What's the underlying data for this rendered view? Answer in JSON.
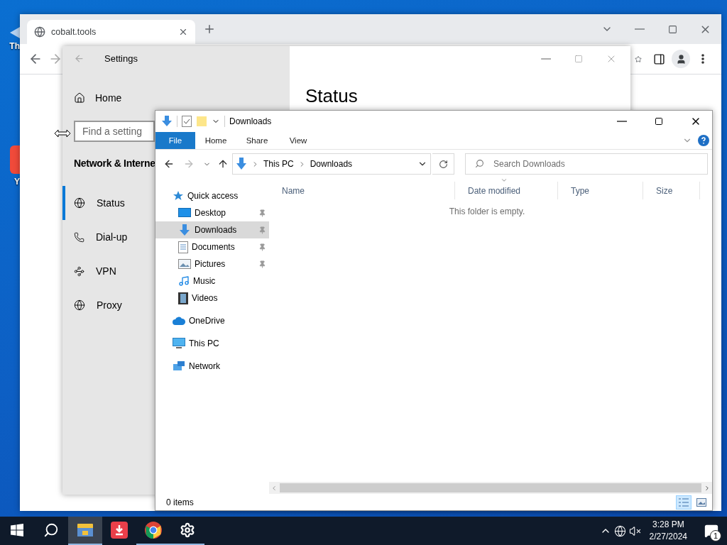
{
  "desktop": {
    "icons": [
      {
        "label": "Th",
        "kind": "shortcut"
      },
      {
        "label": "Y",
        "kind": "app"
      }
    ]
  },
  "browser": {
    "tab": {
      "title": "cobalt.tools"
    }
  },
  "settings": {
    "title": "Settings",
    "home": "Home",
    "search": {
      "placeholder": "Find a setting"
    },
    "section": "Network & Interne",
    "heading": "Status",
    "items": [
      {
        "label": "Status",
        "kind": "globe",
        "selected": true
      },
      {
        "label": "Dial-up",
        "kind": "phone",
        "selected": false
      },
      {
        "label": "VPN",
        "kind": "vpn",
        "selected": false
      },
      {
        "label": "Proxy",
        "kind": "globe",
        "selected": false
      }
    ]
  },
  "explorer": {
    "title": "Downloads",
    "ribbon_tabs": [
      {
        "label": "File",
        "selected": true
      },
      {
        "label": "Home",
        "selected": false
      },
      {
        "label": "Share",
        "selected": false
      },
      {
        "label": "View",
        "selected": false
      }
    ],
    "address": [
      "This PC",
      "Downloads"
    ],
    "search": {
      "placeholder": "Search Downloads"
    },
    "nav": [
      {
        "label": "Quick access",
        "kind": "star",
        "selected": false,
        "pinned": false,
        "children": [
          {
            "label": "Desktop",
            "kind": "desktop",
            "selected": false,
            "pinned": true
          },
          {
            "label": "Downloads",
            "kind": "download",
            "selected": true,
            "pinned": true
          },
          {
            "label": "Documents",
            "kind": "document",
            "selected": false,
            "pinned": true
          },
          {
            "label": "Pictures",
            "kind": "pictures",
            "selected": false,
            "pinned": true
          },
          {
            "label": "Music",
            "kind": "music",
            "selected": false,
            "pinned": false
          },
          {
            "label": "Videos",
            "kind": "videos",
            "selected": false,
            "pinned": false
          }
        ]
      },
      {
        "label": "OneDrive",
        "kind": "cloud",
        "selected": false,
        "pinned": false
      },
      {
        "label": "This PC",
        "kind": "pc",
        "selected": false,
        "pinned": false
      },
      {
        "label": "Network",
        "kind": "network",
        "selected": false,
        "pinned": false
      }
    ],
    "columns": [
      {
        "label": "Name",
        "sorted": false
      },
      {
        "label": "Date modified",
        "sorted": true
      },
      {
        "label": "Type",
        "sorted": false
      },
      {
        "label": "Size",
        "sorted": false
      }
    ],
    "empty_message": "This folder is empty.",
    "status": "0 items",
    "views": [
      {
        "kind": "details",
        "selected": true
      },
      {
        "kind": "large",
        "selected": false
      }
    ]
  },
  "taskbar": {
    "apps": [
      {
        "kind": "explorer",
        "running": true,
        "selected": true
      },
      {
        "kind": "downloader",
        "running": false,
        "selected": false
      },
      {
        "kind": "chrome",
        "running": true,
        "selected": false
      },
      {
        "kind": "settings",
        "running": true,
        "selected": false
      }
    ],
    "time": "3:28 PM",
    "date": "2/27/2024",
    "notifications": "1"
  }
}
